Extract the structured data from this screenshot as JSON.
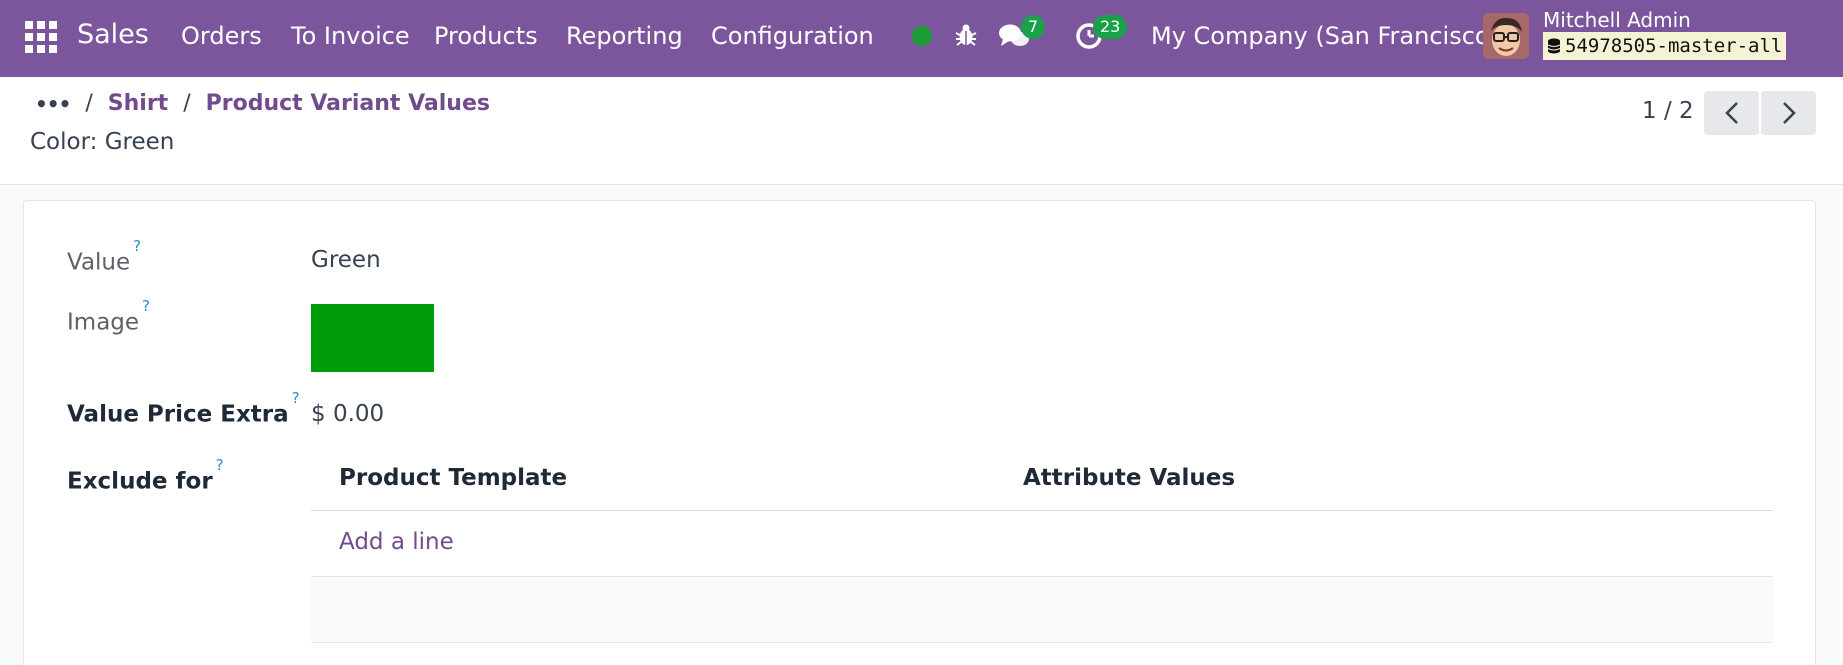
{
  "navbar": {
    "app_name": "Sales",
    "menu": [
      "Orders",
      "To Invoice",
      "Products",
      "Reporting",
      "Configuration"
    ],
    "chat_count": "7",
    "activity_count": "23",
    "company": "My Company (San Francisco)",
    "user_name": "Mitchell Admin",
    "database": "54978505-master-all"
  },
  "breadcrumb": {
    "items": [
      "Shirt",
      "Product Variant Values"
    ],
    "separator": "/"
  },
  "record_title": "Color: Green",
  "pager": {
    "text": "1 / 2"
  },
  "form": {
    "value_label": "Value",
    "value": "Green",
    "image_label": "Image",
    "price_extra_label": "Value Price Extra",
    "price_extra": "$ 0.00",
    "exclude_label": "Exclude for",
    "help_mark": "?",
    "table_columns": [
      "Product Template",
      "Attribute Values"
    ],
    "add_line": "Add a line"
  },
  "colors": {
    "navbar": "#7c569d",
    "link": "#714b8e",
    "swatch": "#009d0b",
    "badge": "#18a149"
  }
}
